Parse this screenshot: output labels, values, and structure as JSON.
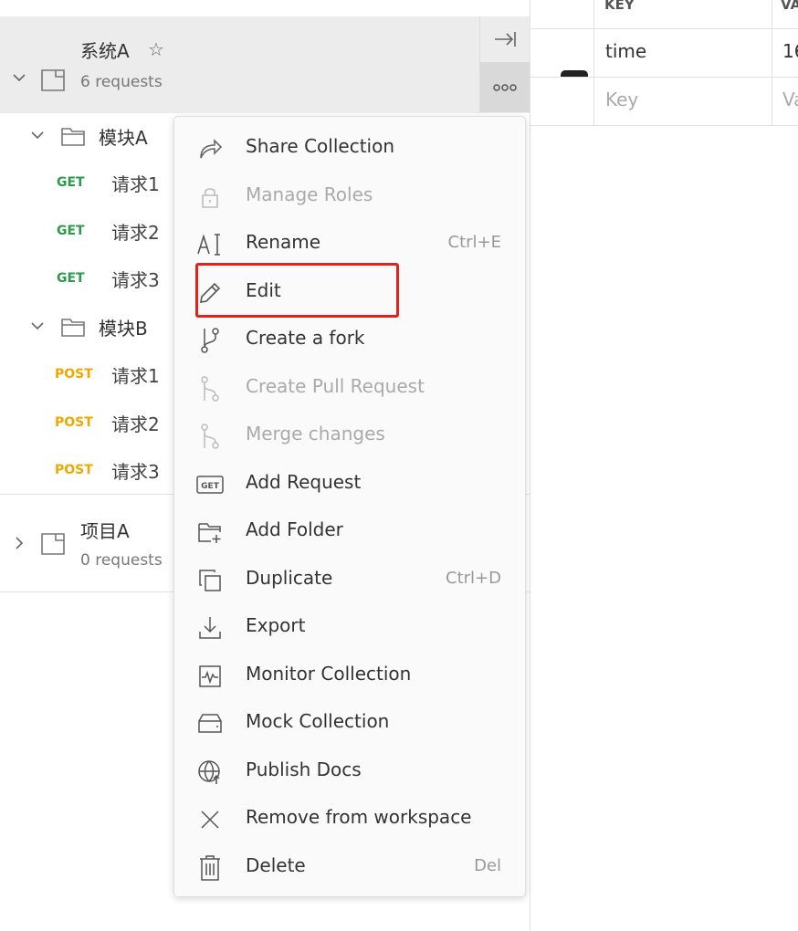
{
  "collections": [
    {
      "name": "系统A",
      "sub": "6 requests"
    },
    {
      "name": "项目A",
      "sub": "0 requests"
    }
  ],
  "folders": [
    {
      "name": "模块A",
      "requests": [
        {
          "method": "GET",
          "name": "请求1"
        },
        {
          "method": "GET",
          "name": "请求2"
        },
        {
          "method": "GET",
          "name": "请求3"
        }
      ]
    },
    {
      "name": "模块B",
      "requests": [
        {
          "method": "POST",
          "name": "请求1"
        },
        {
          "method": "POST",
          "name": "请求2"
        },
        {
          "method": "POST",
          "name": "请求3"
        }
      ]
    }
  ],
  "params": {
    "headers": [
      "KEY",
      "VA"
    ],
    "row": {
      "key": "time",
      "value": "16"
    },
    "placeholder": {
      "key": "Key",
      "value": "Va"
    }
  },
  "menu": [
    {
      "label": "Share Collection",
      "icon": "share-icon",
      "disabled": false,
      "shortcut": ""
    },
    {
      "label": "Manage Roles",
      "icon": "lock-icon",
      "disabled": true,
      "shortcut": ""
    },
    {
      "label": "Rename",
      "icon": "rename-icon",
      "disabled": false,
      "shortcut": "Ctrl+E"
    },
    {
      "label": "Edit",
      "icon": "pencil-icon",
      "disabled": false,
      "shortcut": ""
    },
    {
      "label": "Create a fork",
      "icon": "fork-icon",
      "disabled": false,
      "shortcut": ""
    },
    {
      "label": "Create Pull Request",
      "icon": "pull-request-icon",
      "disabled": true,
      "shortcut": ""
    },
    {
      "label": "Merge changes",
      "icon": "merge-icon",
      "disabled": true,
      "shortcut": ""
    },
    {
      "label": "Add Request",
      "icon": "get-request-icon",
      "disabled": false,
      "shortcut": ""
    },
    {
      "label": "Add Folder",
      "icon": "add-folder-icon",
      "disabled": false,
      "shortcut": ""
    },
    {
      "label": "Duplicate",
      "icon": "duplicate-icon",
      "disabled": false,
      "shortcut": "Ctrl+D"
    },
    {
      "label": "Export",
      "icon": "export-icon",
      "disabled": false,
      "shortcut": ""
    },
    {
      "label": "Monitor Collection",
      "icon": "monitor-icon",
      "disabled": false,
      "shortcut": ""
    },
    {
      "label": "Mock Collection",
      "icon": "mock-server-icon",
      "disabled": false,
      "shortcut": ""
    },
    {
      "label": "Publish Docs",
      "icon": "globe-icon",
      "disabled": false,
      "shortcut": ""
    },
    {
      "label": "Remove from workspace",
      "icon": "close-icon",
      "disabled": false,
      "shortcut": ""
    },
    {
      "label": "Delete",
      "icon": "trash-icon",
      "disabled": false,
      "shortcut": "Del"
    }
  ],
  "menu_get_icon_text": "GET",
  "colors": {
    "highlight": "#e3231b",
    "get": "#2b9b4b",
    "post": "#f0a800"
  }
}
